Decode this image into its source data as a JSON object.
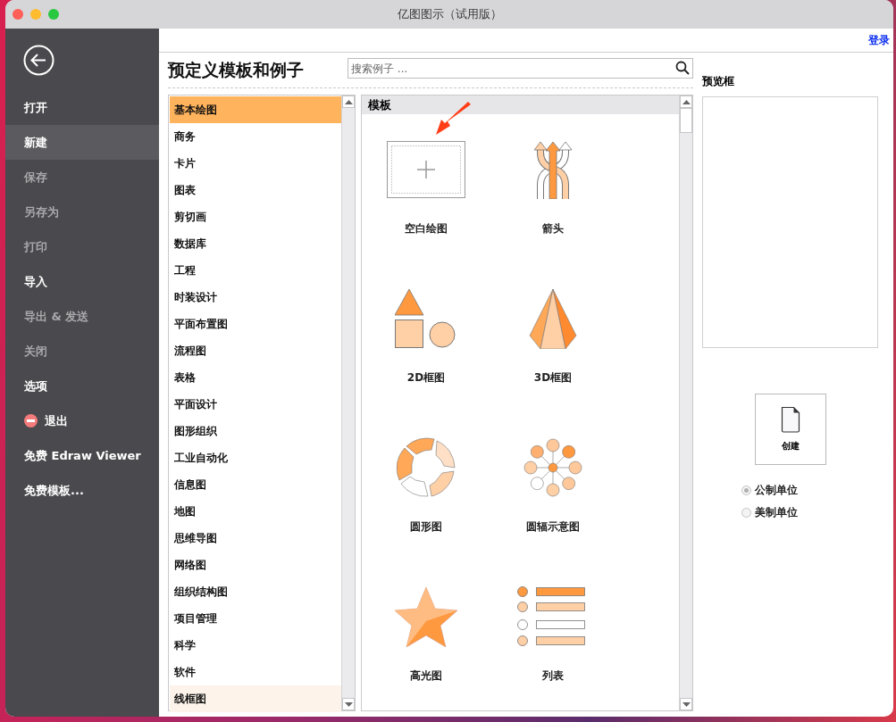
{
  "window": {
    "title": "亿图图示（试用版）"
  },
  "sidebar": {
    "items": [
      {
        "label": "打开",
        "disabled": false,
        "selected": false
      },
      {
        "label": "新建",
        "disabled": false,
        "selected": true
      },
      {
        "label": "保存",
        "disabled": true,
        "selected": false
      },
      {
        "label": "另存为",
        "disabled": true,
        "selected": false
      },
      {
        "label": "打印",
        "disabled": true,
        "selected": false
      },
      {
        "label": "导入",
        "disabled": false,
        "selected": false
      },
      {
        "label": "导出 & 发送",
        "disabled": true,
        "selected": false
      },
      {
        "label": "关闭",
        "disabled": true,
        "selected": false
      },
      {
        "label": "选项",
        "disabled": false,
        "selected": false
      },
      {
        "label": "退出",
        "disabled": false,
        "selected": false,
        "kind": "exit"
      },
      {
        "label": "免费 Edraw Viewer",
        "disabled": false,
        "selected": false
      },
      {
        "label": "免费模板...",
        "disabled": false,
        "selected": false
      }
    ]
  },
  "top_bar": {
    "login_link": "登录"
  },
  "heading": "预定义模板和例子",
  "search": {
    "placeholder": "搜索例子 ..."
  },
  "categories": [
    {
      "label": "基本绘图",
      "selected": true,
      "hovered": false
    },
    {
      "label": "商务",
      "selected": false,
      "hovered": false
    },
    {
      "label": "卡片",
      "selected": false,
      "hovered": false
    },
    {
      "label": "图表",
      "selected": false,
      "hovered": false
    },
    {
      "label": "剪切画",
      "selected": false,
      "hovered": false
    },
    {
      "label": "数据库",
      "selected": false,
      "hovered": false
    },
    {
      "label": "工程",
      "selected": false,
      "hovered": false
    },
    {
      "label": "时装设计",
      "selected": false,
      "hovered": false
    },
    {
      "label": "平面布置图",
      "selected": false,
      "hovered": false
    },
    {
      "label": "流程图",
      "selected": false,
      "hovered": false
    },
    {
      "label": "表格",
      "selected": false,
      "hovered": false
    },
    {
      "label": "平面设计",
      "selected": false,
      "hovered": false
    },
    {
      "label": "图形组织",
      "selected": false,
      "hovered": false
    },
    {
      "label": "工业自动化",
      "selected": false,
      "hovered": false
    },
    {
      "label": "信息图",
      "selected": false,
      "hovered": false
    },
    {
      "label": "地图",
      "selected": false,
      "hovered": false
    },
    {
      "label": "思维导图",
      "selected": false,
      "hovered": false
    },
    {
      "label": "网络图",
      "selected": false,
      "hovered": false
    },
    {
      "label": "组织结构图",
      "selected": false,
      "hovered": false
    },
    {
      "label": "项目管理",
      "selected": false,
      "hovered": false
    },
    {
      "label": "科学",
      "selected": false,
      "hovered": false
    },
    {
      "label": "软件",
      "selected": false,
      "hovered": false
    },
    {
      "label": "线框图",
      "selected": false,
      "hovered": true
    }
  ],
  "templates": {
    "header": "模板",
    "items": [
      {
        "label": "空白绘图",
        "kind": "blank"
      },
      {
        "label": "箭头",
        "kind": "arrows"
      },
      {
        "label": "2D框图",
        "kind": "shapes2d"
      },
      {
        "label": "3D框图",
        "kind": "pyramid"
      },
      {
        "label": "圆形图",
        "kind": "ring"
      },
      {
        "label": "圆辐示意图",
        "kind": "radial"
      },
      {
        "label": "高光图",
        "kind": "star"
      },
      {
        "label": "列表",
        "kind": "list"
      }
    ]
  },
  "preview": {
    "label": "预览框",
    "create_button": "创建",
    "units": [
      {
        "label": "公制单位",
        "selected": true
      },
      {
        "label": "美制单位",
        "selected": false
      }
    ]
  }
}
